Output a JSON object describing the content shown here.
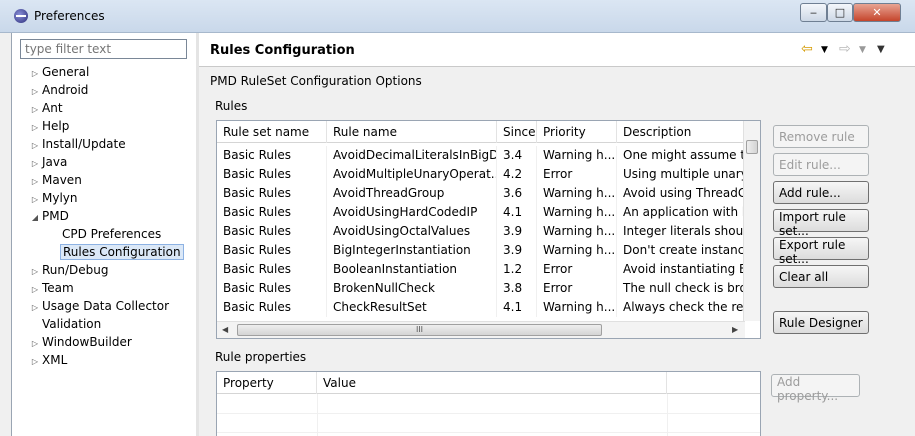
{
  "window": {
    "title": "Preferences",
    "minimize": "‒",
    "maximize": "□",
    "close": "✕"
  },
  "sidebar": {
    "filter_placeholder": "type filter text",
    "items": [
      {
        "label": "General",
        "expander": "▷"
      },
      {
        "label": "Android",
        "expander": "▷"
      },
      {
        "label": "Ant",
        "expander": "▷"
      },
      {
        "label": "Help",
        "expander": "▷"
      },
      {
        "label": "Install/Update",
        "expander": "▷"
      },
      {
        "label": "Java",
        "expander": "▷"
      },
      {
        "label": "Maven",
        "expander": "▷"
      },
      {
        "label": "Mylyn",
        "expander": "▷"
      },
      {
        "label": "PMD",
        "expander": "◢"
      },
      {
        "label": "CPD Preferences",
        "expander": ""
      },
      {
        "label": "Rules Configuration",
        "expander": ""
      },
      {
        "label": "Run/Debug",
        "expander": "▷"
      },
      {
        "label": "Team",
        "expander": "▷"
      },
      {
        "label": "Usage Data Collector",
        "expander": "▷"
      },
      {
        "label": "Validation",
        "expander": ""
      },
      {
        "label": "WindowBuilder",
        "expander": "▷"
      },
      {
        "label": "XML",
        "expander": "▷"
      }
    ],
    "selected": "Rules Configuration"
  },
  "page": {
    "title": "Rules Configuration",
    "nav": {
      "back": "⇦",
      "back_menu": "▼",
      "forward": "⇨",
      "forward_menu": "▼",
      "view_menu": "▼"
    },
    "subtitle": "PMD RuleSet Configuration Options",
    "rules_label": "Rules",
    "rules_columns": [
      "Rule set name",
      "Rule name",
      "Since",
      "Priority",
      "Description"
    ],
    "rules_rows": [
      [
        "Basic Rules",
        "AvoidDecimalLiteralsInBigD...",
        "3.4",
        "Warning h...",
        "One might assume tha"
      ],
      [
        "Basic Rules",
        "AvoidMultipleUnaryOperat...",
        "4.2",
        "Error",
        "Using multiple unary o"
      ],
      [
        "Basic Rules",
        "AvoidThreadGroup",
        "3.6",
        "Warning h...",
        "Avoid using ThreadGro"
      ],
      [
        "Basic Rules",
        "AvoidUsingHardCodedIP",
        "4.1",
        "Warning h...",
        "An application with ha"
      ],
      [
        "Basic Rules",
        "AvoidUsingOctalValues",
        "3.9",
        "Warning h...",
        "Integer literals should r"
      ],
      [
        "Basic Rules",
        "BigIntegerInstantiation",
        "3.9",
        "Warning h...",
        "Don't create instances"
      ],
      [
        "Basic Rules",
        "BooleanInstantiation",
        "1.2",
        "Error",
        "Avoid instantiating Boo"
      ],
      [
        "Basic Rules",
        "BrokenNullCheck",
        "3.8",
        "Error",
        "The null check is broke"
      ],
      [
        "Basic Rules",
        "CheckResultSet",
        "4.1",
        "Warning h...",
        "Always check the retur"
      ]
    ],
    "hscroll_grip": "III",
    "buttons": {
      "remove_rule": "Remove rule",
      "edit_rule": "Edit rule...",
      "add_rule": "Add rule...",
      "import_rule_set": "Import rule set...",
      "export_rule_set": "Export rule set...",
      "clear_all": "Clear all",
      "rule_designer": "Rule Designer",
      "add_property": "Add property..."
    },
    "props_label": "Rule properties",
    "props_columns": [
      "Property",
      "Value"
    ]
  }
}
